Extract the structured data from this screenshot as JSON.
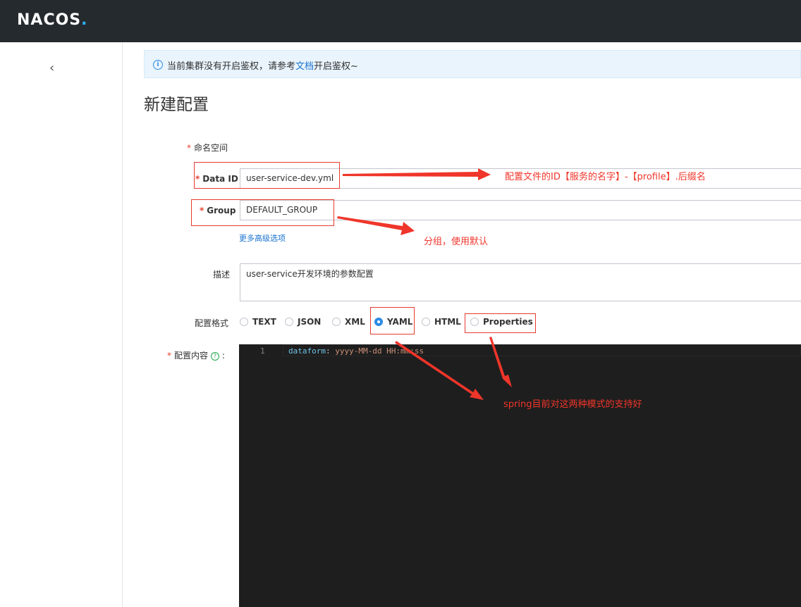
{
  "header": {
    "logo": "NACOS",
    "logo_dot": "."
  },
  "sidebar": {
    "collapse_glyph": "‹"
  },
  "notice": {
    "text_before": "当前集群没有开启鉴权，请参考",
    "link": "文档",
    "text_after": "开启鉴权~"
  },
  "page": {
    "title": "新建配置"
  },
  "form": {
    "namespace_label": "命名空间",
    "dataid_label": "Data ID",
    "dataid_value": "user-service-dev.yml",
    "group_label": "Group",
    "group_value": "DEFAULT_GROUP",
    "more_options": "更多高级选项",
    "desc_label": "描述",
    "desc_value": "user-service开发环境的参数配置",
    "format_label": "配置格式",
    "formats": [
      "TEXT",
      "JSON",
      "XML",
      "YAML",
      "HTML",
      "Properties"
    ],
    "selected_format": "YAML",
    "content_label": "配置内容",
    "content_colon": ":",
    "required_mark": "*"
  },
  "editor": {
    "line_number": "1",
    "key": "dataform",
    "sep": ": ",
    "value": "yyyy-MM-dd HH:mm:ss"
  },
  "annotations": {
    "dataid_note": "配置文件的ID【服务的名字】-【profile】.后缀名",
    "group_note": "分组，使用默认",
    "format_note": "spring目前对这两种模式的支持好"
  },
  "colors": {
    "accent": "#2b8ce6",
    "topbar": "#252a2f",
    "annotation_red": "#e53b30",
    "editor_bg": "#1e1e1e"
  }
}
